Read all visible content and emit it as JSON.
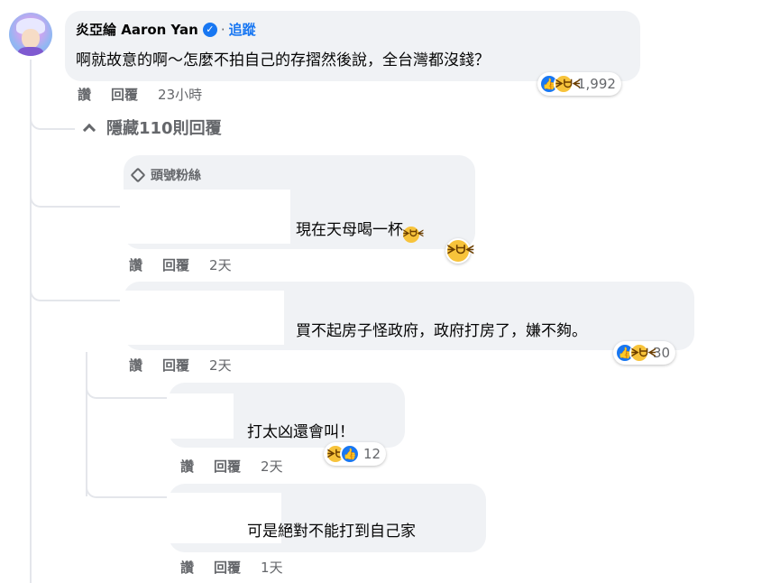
{
  "main_comment": {
    "author": "炎亞綸 Aaron Yan",
    "separator": "·",
    "follow_label": "追蹤",
    "verified_glyph": "✓",
    "text": "啊就故意的啊～怎麼不拍自己的存摺然後說，全台灣都沒錢？",
    "reaction_count": "1,992",
    "reaction_icons": [
      "like-icon",
      "haha-icon"
    ],
    "actions": {
      "like": "讚",
      "reply": "回覆",
      "time": "23小時"
    }
  },
  "hide_replies_label": "隱藏110則回覆",
  "replies": [
    {
      "badge": "頭號粉絲",
      "text": "現在天母喝一杯",
      "trailing_emoji": "🤣",
      "reaction_icons": [
        "haha-icon"
      ],
      "actions": {
        "like": "讚",
        "reply": "回覆",
        "time": "2天"
      }
    },
    {
      "text": "買不起房子怪政府，政府打房了，嫌不夠。",
      "reaction_count": "30",
      "reaction_icons": [
        "like-icon",
        "haha-icon"
      ],
      "actions": {
        "like": "讚",
        "reply": "回覆",
        "time": "2天"
      }
    },
    {
      "text": "打太凶還會叫！",
      "reaction_count": "12",
      "reaction_icons": [
        "haha-icon",
        "like-icon"
      ],
      "actions": {
        "like": "讚",
        "reply": "回覆",
        "time": "2天"
      }
    },
    {
      "text": "可是絕對不能打到自己家",
      "actions": {
        "like": "讚",
        "reply": "回覆",
        "time": "1天"
      }
    }
  ],
  "colors": {
    "bubble": "#f0f2f5",
    "accent": "#1877f2",
    "muted_text": "#65676b",
    "haha_yellow": "#f7c33b"
  }
}
